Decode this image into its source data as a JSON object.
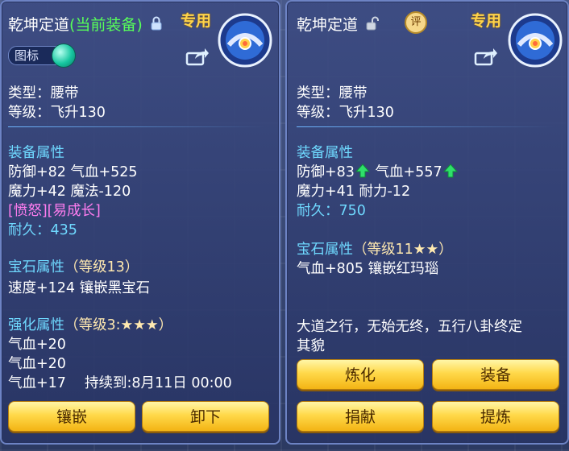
{
  "left": {
    "title": "乾坤定道",
    "title_sub": "(当前装备)",
    "exclusive": "专用",
    "icon_toggle": "图标",
    "type_line": "类型：腰带",
    "level_line": "等级：飞升130",
    "equip_header": "装备属性",
    "stat1": "防御+82 气血+525",
    "stat2": "魔力+42 魔法-120",
    "special": "[愤怒][易成长]",
    "durability_label": "耐久：",
    "durability_value": "435",
    "gem_header": "宝石属性",
    "gem_level": "（等级13）",
    "gem_line": "速度+124 镶嵌黑宝石",
    "enhance_header": "强化属性",
    "enhance_level": "（等级3:★★★）",
    "enh1": "气血+20",
    "enh2": "气血+20",
    "enh3": "气血+17　 持续到:8月11日 00:00",
    "btn_inlay": "镶嵌",
    "btn_unequip": "卸下"
  },
  "right": {
    "title": "乾坤定道",
    "exclusive": "专用",
    "rate_badge": "评",
    "type_line": "类型：腰带",
    "level_line": "等级：飞升130",
    "equip_header": "装备属性",
    "stat1a": "防御+83",
    "stat1b": "气血+557",
    "stat2": "魔力+41 耐力-12",
    "durability_label": "耐久：",
    "durability_value": "750",
    "gem_header": "宝石属性",
    "gem_level": "（等级11★★）",
    "gem_line": "气血+805 镶嵌红玛瑙",
    "desc1": "大道之行，无始无终，五行八卦终定",
    "desc2": "其貌",
    "btn_refine": "炼化",
    "btn_equip": "装备",
    "btn_donate": "捐献",
    "btn_extract": "提炼"
  },
  "colors": {
    "green_text": "#57ff5a",
    "cyan_text": "#6fd9ff",
    "pink_text": "#ff7df0",
    "gold_text": "#ffd44a"
  }
}
